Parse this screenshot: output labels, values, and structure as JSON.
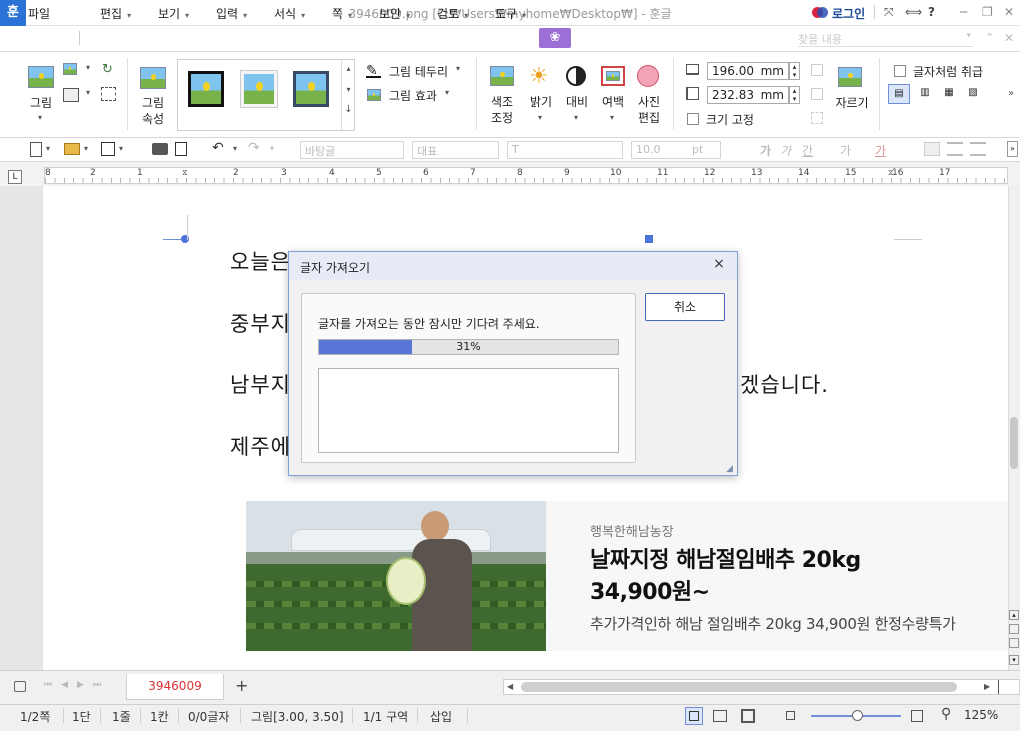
{
  "app": {
    "logo": "훈",
    "window_title": "3946009.png [C:₩Users₩myhome₩Desktop₩] - 훈글",
    "login": "로그인",
    "help": "?"
  },
  "menu": {
    "file": "파일",
    "items": [
      "편집",
      "보기",
      "입력",
      "서식",
      "쪽",
      "보안",
      "검토",
      "도구"
    ],
    "search_placeholder": "찾을 내용"
  },
  "ribbon": {
    "picture": "그림",
    "picture_props_1": "그림",
    "picture_props_2": "속성",
    "picture_border": "그림 테두리",
    "picture_effect": "그림 효과",
    "color_adjust_1": "색조",
    "color_adjust_2": "조정",
    "brightness": "밝기",
    "contrast": "대비",
    "margin": "여백",
    "photo_edit_1": "사진",
    "photo_edit_2": "편집",
    "width_value": "196.00",
    "height_value": "232.83",
    "unit": "mm",
    "fixed_size": "크기 고정",
    "crop": "자르기",
    "treat_as_char": "글자처럼 취급"
  },
  "format_bar": {
    "style": "바탕글",
    "font_lang": "대표",
    "font": "T",
    "size": "10.0",
    "size_unit": "pt",
    "char_buttons": [
      "가",
      "가",
      "간",
      "가",
      "가"
    ]
  },
  "ruler": {
    "corner": "L",
    "numbers": [
      "8",
      "2",
      "1",
      "2",
      "3",
      "4",
      "5",
      "6",
      "7",
      "8",
      "9",
      "10",
      "11",
      "12",
      "13",
      "14",
      "15",
      "16",
      "17"
    ]
  },
  "document": {
    "lines": [
      "오늘은",
      "중부지",
      "남부지",
      "제주에"
    ],
    "line3_tail": "겠습니다.",
    "ad": {
      "farm": "행복한해남농장",
      "title_line1": "날짜지정 해남절임배추 20kg",
      "title_line2": "34,900원~",
      "subtitle": "추가가격인하 해남 절임배추 20kg 34,900원 한정수량특가"
    }
  },
  "dialog": {
    "title": "글자 가져오기",
    "close": "×",
    "message": "글자를 가져오는 동안 잠시만 기다려 주세요.",
    "progress": 0.31,
    "progress_text": "31%",
    "cancel": "취소"
  },
  "tabs": {
    "doc_tab": "3946009",
    "add": "+"
  },
  "status": {
    "page": "1/2쪽",
    "column": "1단",
    "line": "1줄",
    "col": "1칸",
    "chars": "0/0글자",
    "object": "그림[3.00, 3.50]",
    "section": "1/1 구역",
    "mode": "삽입",
    "zoom": "125%"
  }
}
